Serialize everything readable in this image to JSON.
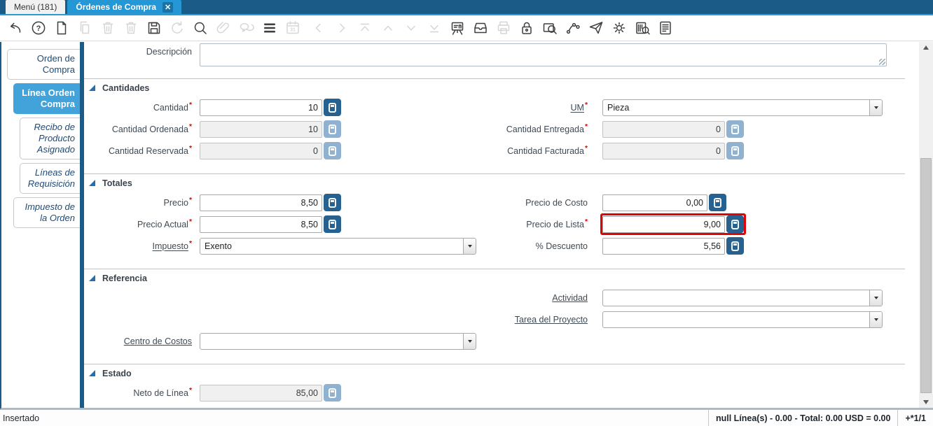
{
  "meta": {
    "required_mark": "*"
  },
  "window": {
    "tabs": [
      {
        "label": "Menú (181)"
      },
      {
        "label": "Órdenes de Compra",
        "active": true,
        "close_icon": "✕"
      }
    ]
  },
  "toolbar": {
    "icons": [
      {
        "name": "undo",
        "enabled": true
      },
      {
        "name": "help",
        "enabled": true
      },
      {
        "name": "new-record",
        "enabled": true
      },
      {
        "name": "copy-record",
        "enabled": false
      },
      {
        "name": "delete-record",
        "enabled": false
      },
      {
        "name": "delete-selection",
        "enabled": false
      },
      {
        "name": "save",
        "enabled": true
      },
      {
        "name": "refresh",
        "enabled": false
      },
      {
        "name": "find",
        "enabled": true
      },
      {
        "name": "attachment",
        "enabled": false
      },
      {
        "name": "chat",
        "enabled": false
      },
      {
        "name": "toggle-grid",
        "enabled": true
      },
      {
        "name": "calendar",
        "enabled": false
      },
      {
        "name": "previous-record",
        "enabled": false
      },
      {
        "name": "next-record",
        "enabled": false
      },
      {
        "name": "first-record",
        "enabled": false
      },
      {
        "name": "parent-record",
        "enabled": false
      },
      {
        "name": "detail-record",
        "enabled": false
      },
      {
        "name": "last-record",
        "enabled": false
      },
      {
        "name": "chart",
        "enabled": true
      },
      {
        "name": "archive",
        "enabled": true
      },
      {
        "name": "print",
        "enabled": false
      },
      {
        "name": "lock",
        "enabled": true
      },
      {
        "name": "zoom-across",
        "enabled": true
      },
      {
        "name": "workflow",
        "enabled": true
      },
      {
        "name": "requests",
        "enabled": true
      },
      {
        "name": "process",
        "enabled": true
      },
      {
        "name": "product-info",
        "enabled": true
      },
      {
        "name": "report",
        "enabled": true
      }
    ]
  },
  "sidebar": {
    "tabs": [
      {
        "label": "Orden de Compra",
        "level": 0,
        "active": false,
        "italic": false
      },
      {
        "label": "Línea Orden Compra",
        "level": 1,
        "active": true,
        "italic": false
      },
      {
        "label": "Recibo de Producto Asignado",
        "level": 2,
        "active": false,
        "italic": true
      },
      {
        "label": "Líneas de Requisición",
        "level": 2,
        "active": false,
        "italic": true
      },
      {
        "label": "Impuesto de la Orden",
        "level": 1,
        "active": false,
        "italic": true
      }
    ]
  },
  "form": {
    "description": {
      "label": "Descripción",
      "value": ""
    },
    "sections": [
      {
        "title": "Cantidades",
        "rows": [
          [
            {
              "label": "Cantidad",
              "required": true,
              "type": "number",
              "value": "10"
            },
            {
              "label": "UM",
              "required": true,
              "link": true,
              "type": "combo",
              "value": "Pieza"
            }
          ],
          [
            {
              "label": "Cantidad Ordenada",
              "required": true,
              "type": "number",
              "value": "10",
              "readonly": true
            },
            {
              "label": "Cantidad Entregada",
              "required": true,
              "type": "number",
              "value": "0",
              "readonly": true
            }
          ],
          [
            {
              "label": "Cantidad Reservada",
              "required": true,
              "type": "number",
              "value": "0",
              "readonly": true
            },
            {
              "label": "Cantidad Facturada",
              "required": true,
              "type": "number",
              "value": "0",
              "readonly": true
            }
          ]
        ]
      },
      {
        "title": "Totales",
        "rows": [
          [
            {
              "label": "Precio",
              "required": true,
              "type": "number",
              "value": "8,50"
            },
            {
              "label": "Precio de Costo",
              "type": "number",
              "value": "0,00",
              "narrow": true
            }
          ],
          [
            {
              "label": "Precio Actual",
              "required": true,
              "type": "number",
              "value": "8,50"
            },
            {
              "label": "Precio de Lista",
              "required": true,
              "type": "number",
              "value": "9,00",
              "highlight": true
            }
          ],
          [
            {
              "label": "Impuesto",
              "required": true,
              "link": true,
              "type": "combo",
              "value": "Exento"
            },
            {
              "label": "% Descuento",
              "type": "number",
              "value": "5,56"
            }
          ]
        ]
      },
      {
        "title": "Referencia",
        "rows": [
          [
            null,
            {
              "label": "Actividad",
              "link": true,
              "type": "combo",
              "value": ""
            }
          ],
          [
            null,
            {
              "label": "Tarea del Proyecto",
              "link": true,
              "type": "combo",
              "value": ""
            }
          ],
          [
            {
              "label": "Centro de Costos",
              "link": true,
              "type": "combo",
              "value": ""
            },
            null
          ]
        ]
      },
      {
        "title": "Estado",
        "rows": [
          [
            {
              "label": "Neto de Línea",
              "required": true,
              "type": "number",
              "value": "85,00",
              "readonly": true
            },
            null
          ]
        ]
      }
    ]
  },
  "statusbar": {
    "left": "Insertado",
    "summary": "null Línea(s) - 0.00 - Total: 0.00 USD = 0.00",
    "position": "+*1/1"
  }
}
